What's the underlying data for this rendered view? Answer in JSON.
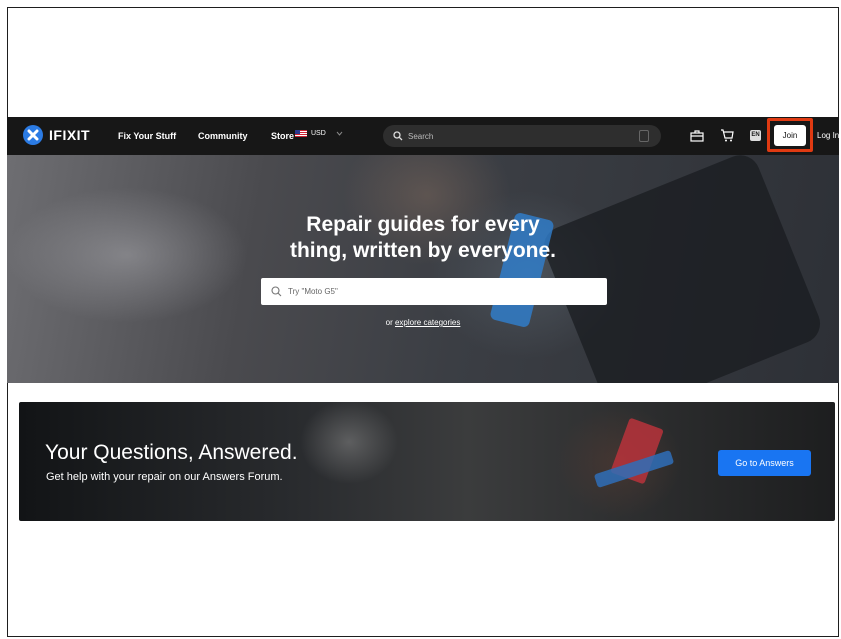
{
  "nav": {
    "brand": "IFIXIT",
    "links": [
      "Fix Your Stuff",
      "Community",
      "Store"
    ],
    "currency": "USD",
    "search_placeholder": "Search",
    "lang": "EN",
    "join_label": "Join",
    "login_label": "Log In"
  },
  "hero": {
    "title_line1": "Repair guides for every",
    "title_line2": "thing, written by everyone.",
    "search_placeholder": "Try \"Moto G5\"",
    "explore_prefix": "or ",
    "explore_link": "explore categories"
  },
  "banner": {
    "title": "Your Questions, Answered.",
    "subtitle": "Get help with your repair on our Answers Forum.",
    "button_label": "Go to Answers"
  },
  "colors": {
    "nav_bg": "#171717",
    "accent_blue": "#1975f2",
    "highlight": "#e03a12"
  }
}
